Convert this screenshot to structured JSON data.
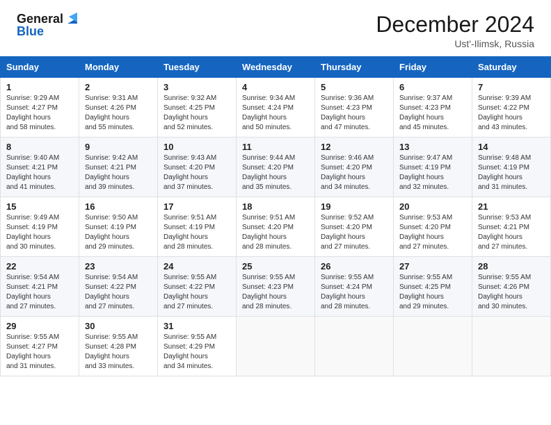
{
  "header": {
    "logo_line1": "General",
    "logo_line2": "Blue",
    "title": "December 2024",
    "subtitle": "Ust'-Ilimsk, Russia"
  },
  "calendar": {
    "headers": [
      "Sunday",
      "Monday",
      "Tuesday",
      "Wednesday",
      "Thursday",
      "Friday",
      "Saturday"
    ],
    "weeks": [
      [
        {
          "day": "1",
          "sunrise": "9:29 AM",
          "sunset": "4:27 PM",
          "daylight": "6 hours and 58 minutes."
        },
        {
          "day": "2",
          "sunrise": "9:31 AM",
          "sunset": "4:26 PM",
          "daylight": "6 hours and 55 minutes."
        },
        {
          "day": "3",
          "sunrise": "9:32 AM",
          "sunset": "4:25 PM",
          "daylight": "6 hours and 52 minutes."
        },
        {
          "day": "4",
          "sunrise": "9:34 AM",
          "sunset": "4:24 PM",
          "daylight": "6 hours and 50 minutes."
        },
        {
          "day": "5",
          "sunrise": "9:36 AM",
          "sunset": "4:23 PM",
          "daylight": "6 hours and 47 minutes."
        },
        {
          "day": "6",
          "sunrise": "9:37 AM",
          "sunset": "4:23 PM",
          "daylight": "6 hours and 45 minutes."
        },
        {
          "day": "7",
          "sunrise": "9:39 AM",
          "sunset": "4:22 PM",
          "daylight": "6 hours and 43 minutes."
        }
      ],
      [
        {
          "day": "8",
          "sunrise": "9:40 AM",
          "sunset": "4:21 PM",
          "daylight": "6 hours and 41 minutes."
        },
        {
          "day": "9",
          "sunrise": "9:42 AM",
          "sunset": "4:21 PM",
          "daylight": "6 hours and 39 minutes."
        },
        {
          "day": "10",
          "sunrise": "9:43 AM",
          "sunset": "4:20 PM",
          "daylight": "6 hours and 37 minutes."
        },
        {
          "day": "11",
          "sunrise": "9:44 AM",
          "sunset": "4:20 PM",
          "daylight": "6 hours and 35 minutes."
        },
        {
          "day": "12",
          "sunrise": "9:46 AM",
          "sunset": "4:20 PM",
          "daylight": "6 hours and 34 minutes."
        },
        {
          "day": "13",
          "sunrise": "9:47 AM",
          "sunset": "4:19 PM",
          "daylight": "6 hours and 32 minutes."
        },
        {
          "day": "14",
          "sunrise": "9:48 AM",
          "sunset": "4:19 PM",
          "daylight": "6 hours and 31 minutes."
        }
      ],
      [
        {
          "day": "15",
          "sunrise": "9:49 AM",
          "sunset": "4:19 PM",
          "daylight": "6 hours and 30 minutes."
        },
        {
          "day": "16",
          "sunrise": "9:50 AM",
          "sunset": "4:19 PM",
          "daylight": "6 hours and 29 minutes."
        },
        {
          "day": "17",
          "sunrise": "9:51 AM",
          "sunset": "4:19 PM",
          "daylight": "6 hours and 28 minutes."
        },
        {
          "day": "18",
          "sunrise": "9:51 AM",
          "sunset": "4:20 PM",
          "daylight": "6 hours and 28 minutes."
        },
        {
          "day": "19",
          "sunrise": "9:52 AM",
          "sunset": "4:20 PM",
          "daylight": "6 hours and 27 minutes."
        },
        {
          "day": "20",
          "sunrise": "9:53 AM",
          "sunset": "4:20 PM",
          "daylight": "6 hours and 27 minutes."
        },
        {
          "day": "21",
          "sunrise": "9:53 AM",
          "sunset": "4:21 PM",
          "daylight": "6 hours and 27 minutes."
        }
      ],
      [
        {
          "day": "22",
          "sunrise": "9:54 AM",
          "sunset": "4:21 PM",
          "daylight": "6 hours and 27 minutes."
        },
        {
          "day": "23",
          "sunrise": "9:54 AM",
          "sunset": "4:22 PM",
          "daylight": "6 hours and 27 minutes."
        },
        {
          "day": "24",
          "sunrise": "9:55 AM",
          "sunset": "4:22 PM",
          "daylight": "6 hours and 27 minutes."
        },
        {
          "day": "25",
          "sunrise": "9:55 AM",
          "sunset": "4:23 PM",
          "daylight": "6 hours and 28 minutes."
        },
        {
          "day": "26",
          "sunrise": "9:55 AM",
          "sunset": "4:24 PM",
          "daylight": "6 hours and 28 minutes."
        },
        {
          "day": "27",
          "sunrise": "9:55 AM",
          "sunset": "4:25 PM",
          "daylight": "6 hours and 29 minutes."
        },
        {
          "day": "28",
          "sunrise": "9:55 AM",
          "sunset": "4:26 PM",
          "daylight": "6 hours and 30 minutes."
        }
      ],
      [
        {
          "day": "29",
          "sunrise": "9:55 AM",
          "sunset": "4:27 PM",
          "daylight": "6 hours and 31 minutes."
        },
        {
          "day": "30",
          "sunrise": "9:55 AM",
          "sunset": "4:28 PM",
          "daylight": "6 hours and 33 minutes."
        },
        {
          "day": "31",
          "sunrise": "9:55 AM",
          "sunset": "4:29 PM",
          "daylight": "6 hours and 34 minutes."
        },
        null,
        null,
        null,
        null
      ]
    ]
  }
}
